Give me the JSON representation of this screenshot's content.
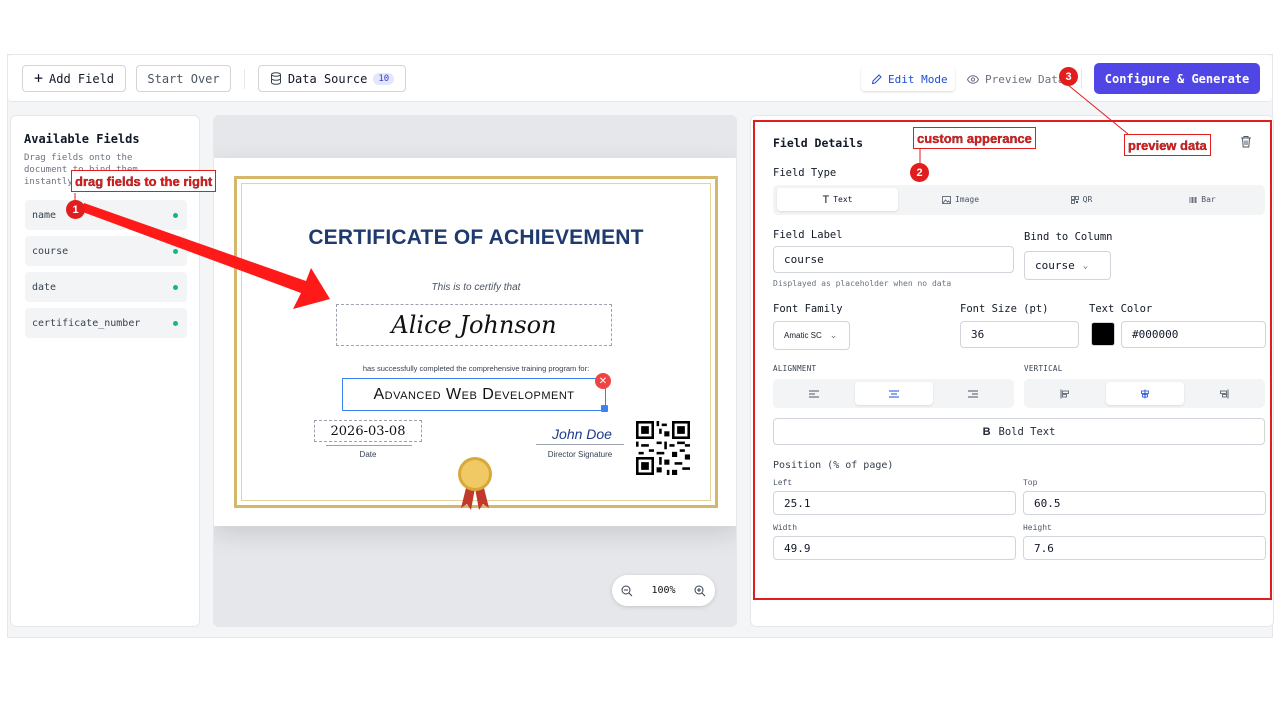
{
  "toolbar": {
    "add_field": "Add Field",
    "start_over": "Start Over",
    "data_source": "Data Source",
    "data_source_count": "10",
    "edit_mode": "Edit Mode",
    "preview_data": "Preview Data",
    "configure_generate": "Configure & Generate"
  },
  "sidebar": {
    "title": "Available Fields",
    "description": "Drag fields onto the document to bind them instantly",
    "items": [
      "name",
      "course",
      "date",
      "certificate_number"
    ]
  },
  "certificate": {
    "title": "CERTIFICATE OF ACHIEVEMENT",
    "certify_text": "This is to certify that",
    "recipient_name": "Alice Johnson",
    "completed_text": "has successfully completed the comprehensive training program for:",
    "course_name": "Advanced Web Development",
    "date_value": "2026-03-08",
    "date_label": "Date",
    "signature": "John Doe",
    "signature_label": "Director Signature"
  },
  "zoom": {
    "level": "100%"
  },
  "details": {
    "title": "Field Details",
    "field_type_label": "Field Type",
    "field_types": [
      "Text",
      "Image",
      "QR",
      "Bar"
    ],
    "selected_field_type": "Text",
    "field_label_label": "Field Label",
    "field_label_value": "course",
    "field_label_help": "Displayed as placeholder when no data",
    "bind_label": "Bind to Column",
    "bind_value": "course",
    "font_family_label": "Font Family",
    "font_family_value": "Amatic SC",
    "font_size_label": "Font Size (pt)",
    "font_size_value": "36",
    "text_color_label": "Text Color",
    "text_color_value": "#000000",
    "alignment_label": "ALIGNMENT",
    "vertical_label": "VERTICAL",
    "bold_label": "Bold Text",
    "position_label": "Position (% of page)",
    "left_label": "Left",
    "left_value": "25.1",
    "top_label": "Top",
    "top_value": "60.5",
    "width_label": "Width",
    "width_value": "49.9",
    "height_label": "Height",
    "height_value": "7.6"
  },
  "annotations": {
    "n1": "1",
    "n2": "2",
    "n3": "3",
    "note1": "drag fields to the right",
    "note2": "custom apperance",
    "note3": "preview data",
    "color": "#e11d1d"
  }
}
